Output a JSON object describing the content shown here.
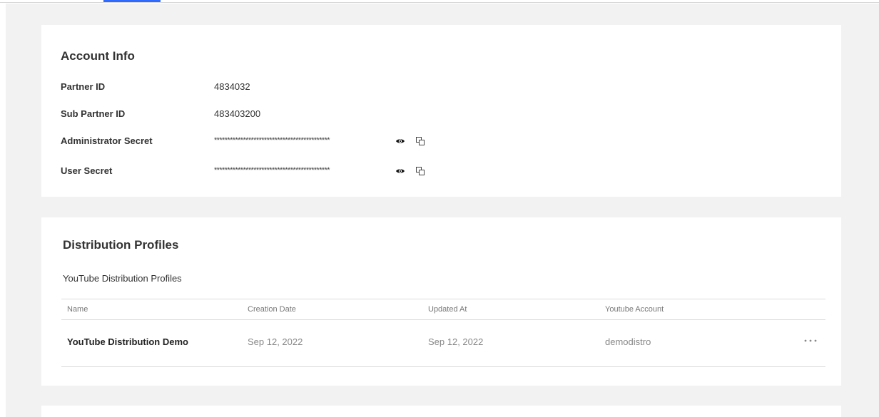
{
  "account_info": {
    "title": "Account Info",
    "rows": [
      {
        "label": "Partner ID",
        "value": "4834032"
      },
      {
        "label": "Sub Partner ID",
        "value": "483403200"
      },
      {
        "label": "Administrator Secret",
        "value": "********************************************"
      },
      {
        "label": "User Secret",
        "value": "********************************************"
      }
    ],
    "icons": {
      "reveal": "eye-icon",
      "copy": "copy-icon"
    }
  },
  "distribution_profiles": {
    "title": "Distribution Profiles",
    "subtitle": "YouTube Distribution Profiles",
    "columns": [
      "Name",
      "Creation Date",
      "Updated At",
      "Youtube Account"
    ],
    "rows": [
      {
        "name": "YouTube Distribution Demo",
        "created": "Sep 12, 2022",
        "updated": "Sep 12, 2022",
        "account": "demodistro"
      }
    ],
    "row_actions_icon": "more-horizontal-icon"
  },
  "colors": {
    "accent": "#2f6bff",
    "page_background": "#f2f2f2",
    "card_background": "#ffffff"
  }
}
